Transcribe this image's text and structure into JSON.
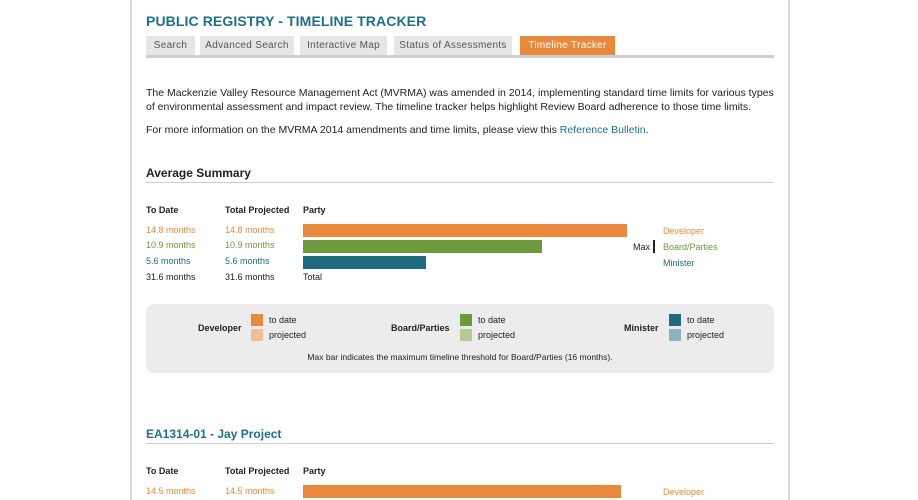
{
  "title": "PUBLIC REGISTRY - TIMELINE TRACKER",
  "tabs": [
    {
      "label": "Search"
    },
    {
      "label": "Advanced Search"
    },
    {
      "label": "Interactive Map"
    },
    {
      "label": "Status of Assessments"
    },
    {
      "label": "Timeline Tracker",
      "active": true
    }
  ],
  "intro": "The Mackenzie Valley Resource Management Act (MVRMA) was amended in 2014, implementing standard time limits for various types of environmental assessment and impact review.  The timeline tracker helps highlight Review Board adherence to those time limits.",
  "info_prefix": "For more information on the MVRMA 2014 amendments and time limits, please view this ",
  "info_link": "Reference Bulletin",
  "info_suffix": ".",
  "summary": {
    "title": "Average Summary",
    "headers": {
      "to_date": "To Date",
      "total_projected": "Total Projected",
      "party": "Party"
    },
    "rows": [
      {
        "to_date": "14.8 months",
        "projected": "14.8 months",
        "party": "Developer",
        "value": 14.8
      },
      {
        "to_date": "10.9 months",
        "projected": "10.9 months",
        "party": "Board/Parties",
        "value": 10.9
      },
      {
        "to_date": "5.6 months",
        "projected": "5.6 months",
        "party": "Minister",
        "value": 5.6
      }
    ],
    "total": {
      "to_date": "31.6 months",
      "projected": "31.6 months",
      "label": "Total"
    },
    "max_label": "Max",
    "max_months": 16
  },
  "legend": {
    "groups": [
      {
        "label": "Developer",
        "to_date": "to date",
        "projected": "projected"
      },
      {
        "label": "Board/Parties",
        "to_date": "to date",
        "projected": "projected"
      },
      {
        "label": "Minister",
        "to_date": "to date",
        "projected": "projected"
      }
    ],
    "note": "Max bar indicates the maximum timeline threshold for Board/Parties (16 months).",
    "colors": {
      "developer": "#e8893c",
      "developer_projected": "#f2bd96",
      "board": "#6d9a3c",
      "board_projected": "#b3cc96",
      "minister": "#1e6b80",
      "minister_projected": "#8cb2bb"
    }
  },
  "project": {
    "title": "EA1314-01 - Jay Project",
    "headers": {
      "to_date": "To Date",
      "total_projected": "Total Projected",
      "party": "Party"
    },
    "rows": [
      {
        "to_date": "14.5 months",
        "projected": "14.5 months",
        "party": "Developer",
        "value": 14.5
      }
    ]
  }
}
